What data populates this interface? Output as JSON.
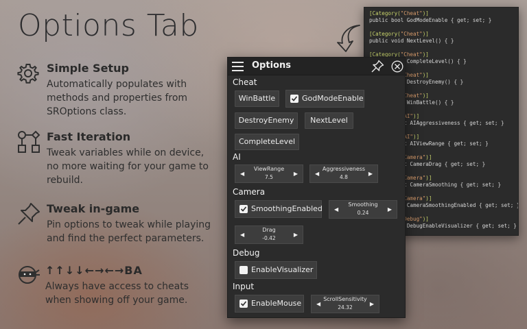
{
  "page": {
    "title": "Options Tab"
  },
  "features": [
    {
      "icon": "gear-icon",
      "heading": "Simple Setup",
      "description": "Automatically populates with methods and properties from SROptions class."
    },
    {
      "icon": "flowchart-icon",
      "heading": "Fast Iteration",
      "description": "Tweak variables while on device, no more waiting for your game to rebuild."
    },
    {
      "icon": "pin-icon",
      "heading": "Tweak in-game",
      "description": "Pin options to tweak while playing and find the perfect parameters."
    },
    {
      "icon": "ninja-icon",
      "heading": "↑↑↓↓←→←→BA",
      "description": "Always have access to cheats when showing off your game."
    }
  ],
  "code_lines": [
    "[Category(\"Cheat\")]",
    "public bool GodModeEnable { get; set; }",
    "",
    "[Category(\"Cheat\")]",
    "public void NextLevel() { }",
    "",
    "[Category(\"Cheat\")]",
    "public void CompleteLevel() { }",
    "",
    "[Category(\"Cheat\")]",
    "public void DestroyEnemy() { }",
    "",
    "[Category(\"Cheat\")]",
    "public void WinBattle() { }",
    "",
    "[Category(\"AI\")]",
    "public float AIAggressiveness { get; set; }",
    "",
    "[Category(\"AI\")]",
    "public float AIViewRange { get; set; }",
    "",
    "[Category(\"Camera\")]",
    "public float CameraDrag { get; set; }",
    "",
    "[Category(\"Camera\")]",
    "public float CameraSmoothing { get; set; }",
    "",
    "[Category(\"Camera\")]",
    "public bool CameraSmoothingEnabled { get; set; }",
    "",
    "[Category(\"Debug\")]",
    "public bool DebugEnableVisualizer { get; set; }"
  ],
  "options_window": {
    "title": "Options",
    "menu_icon": "hamburger-menu-icon",
    "pin_icon": "pin-icon",
    "close_icon": "close-icon",
    "categories": {
      "cheat": {
        "label": "Cheat",
        "win_battle": "WinBattle",
        "god_mode_enable": {
          "label": "GodModeEnable",
          "checked": true
        },
        "destroy_enemy": "DestroyEnemy",
        "next_level": "NextLevel",
        "complete_level": "CompleteLevel"
      },
      "ai": {
        "label": "AI",
        "view_range": {
          "name": "ViewRange",
          "value": "7.5"
        },
        "aggressiveness": {
          "name": "Aggressiveness",
          "value": "4.8"
        }
      },
      "camera": {
        "label": "Camera",
        "smoothing_enabled": {
          "label": "SmoothingEnabled",
          "checked": true
        },
        "smoothing": {
          "name": "Smoothing",
          "value": "0.24"
        },
        "drag": {
          "name": "Drag",
          "value": "-0.42"
        }
      },
      "debug": {
        "label": "Debug",
        "enable_visualizer": {
          "label": "EnableVisualizer",
          "checked": false
        }
      },
      "input": {
        "label": "Input",
        "enable_mouse": {
          "label": "EnableMouse",
          "checked": true
        },
        "scroll_sensitivity": {
          "name": "ScrollSensitivity",
          "value": "24.32"
        }
      }
    }
  },
  "stepper_arrows": {
    "left": "◀",
    "right": "▶"
  },
  "colors": {
    "window_bg": "#2b2b2b",
    "button_bg": "#3d3d3d",
    "code_attribute": "#c8d46b",
    "code_string": "#d69a6a"
  }
}
